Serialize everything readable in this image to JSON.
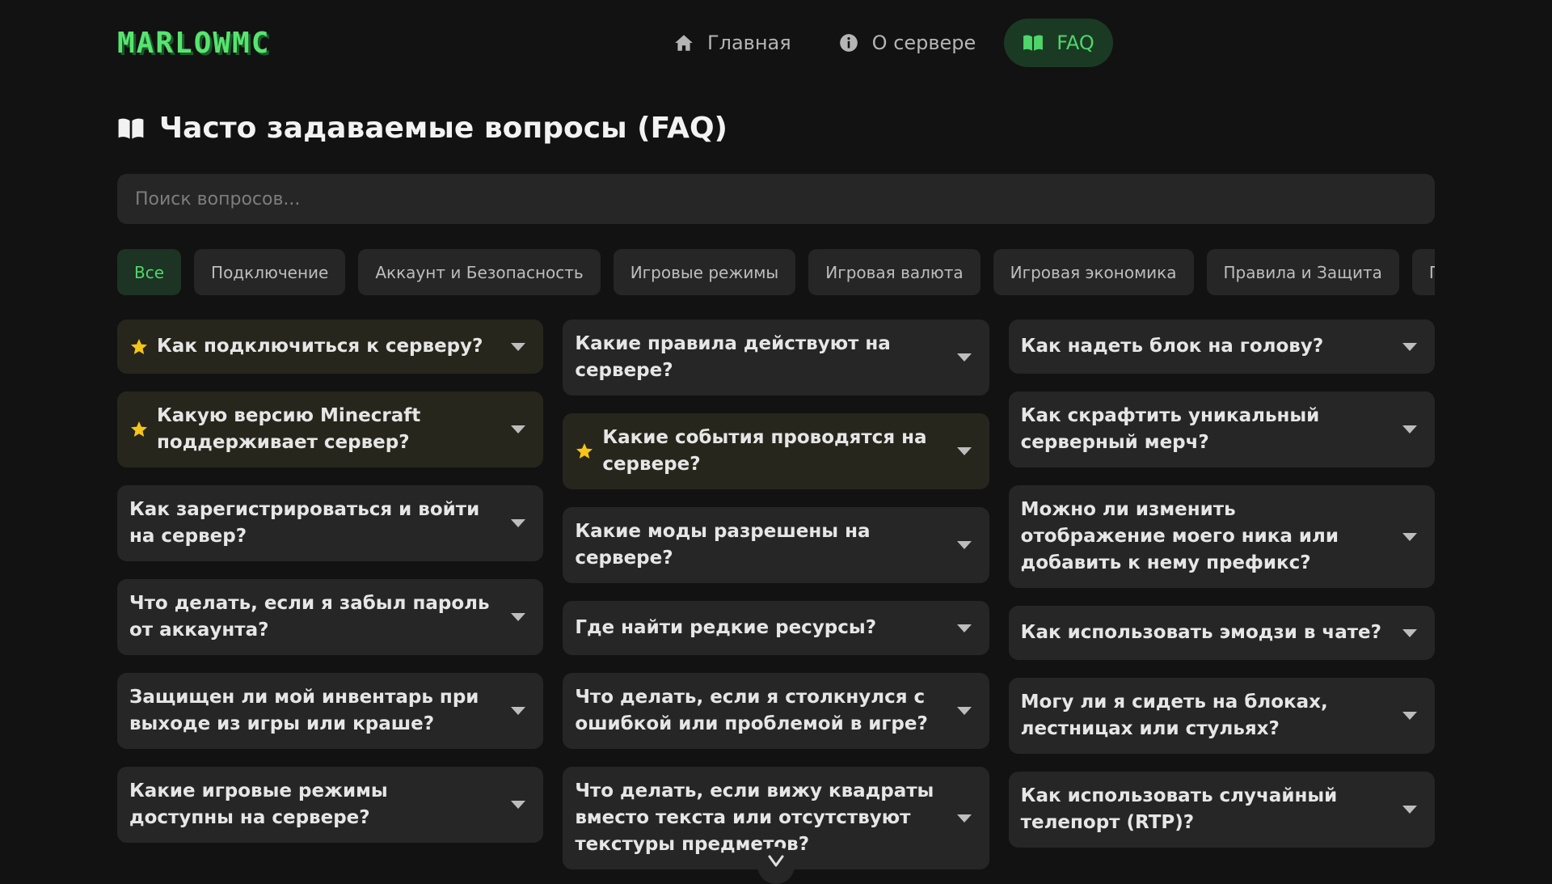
{
  "header": {
    "logo_text": "MARLOWMC",
    "nav": [
      {
        "label": "Главная",
        "icon": "home-icon",
        "active": false
      },
      {
        "label": "О сервере",
        "icon": "info-icon",
        "active": false
      },
      {
        "label": "FAQ",
        "icon": "book-icon",
        "active": true
      }
    ]
  },
  "page": {
    "title": "Часто задаваемые вопросы (FAQ)"
  },
  "search": {
    "placeholder": "Поиск вопросов..."
  },
  "categories": [
    {
      "label": "Все",
      "active": true
    },
    {
      "label": "Подключение"
    },
    {
      "label": "Аккаунт и Безопасность"
    },
    {
      "label": "Игровые режимы"
    },
    {
      "label": "Игровая валюта"
    },
    {
      "label": "Игровая экономика"
    },
    {
      "label": "Правила и Защита"
    },
    {
      "label": "Подде"
    }
  ],
  "faq_columns": [
    [
      {
        "q": "Как подключиться к серверу?",
        "featured": true
      },
      {
        "q": "Какую версию Minecraft поддерживает сервер?",
        "featured": true
      },
      {
        "q": "Как зарегистрироваться и войти на сервер?",
        "featured": false
      },
      {
        "q": "Что делать, если я забыл пароль от аккаунта?",
        "featured": false
      },
      {
        "q": "Защищен ли мой инвентарь при выходе из игры или краше?",
        "featured": false
      },
      {
        "q": "Какие игровые режимы доступны на сервере?",
        "featured": false
      }
    ],
    [
      {
        "q": "Какие правила действуют на сервере?",
        "featured": false
      },
      {
        "q": "Какие события проводятся на сервере?",
        "featured": true
      },
      {
        "q": "Какие моды разрешены на сервере?",
        "featured": false
      },
      {
        "q": "Где найти редкие ресурсы?",
        "featured": false
      },
      {
        "q": "Что делать, если я столкнулся с ошибкой или проблемой в игре?",
        "featured": false
      },
      {
        "q": "Что делать, если вижу квадраты вместо текста или отсутствуют текстуры предметов?",
        "featured": false
      }
    ],
    [
      {
        "q": "Как надеть блок на голову?",
        "featured": false
      },
      {
        "q": "Как скрафтить уникальный серверный мерч?",
        "featured": false
      },
      {
        "q": "Можно ли изменить отображение моего ника или добавить к нему префикс?",
        "featured": false
      },
      {
        "q": "Как использовать эмодзи в чате?",
        "featured": false
      },
      {
        "q": "Могу ли я сидеть на блоках, лестницах или стульях?",
        "featured": false
      },
      {
        "q": "Как использовать случайный телепорт (RTP)?",
        "featured": false
      }
    ]
  ],
  "colors": {
    "background": "#121212",
    "card": "#262626",
    "card_featured": "#27261c",
    "accent": "#4fd66a",
    "star": "#f5c518"
  }
}
